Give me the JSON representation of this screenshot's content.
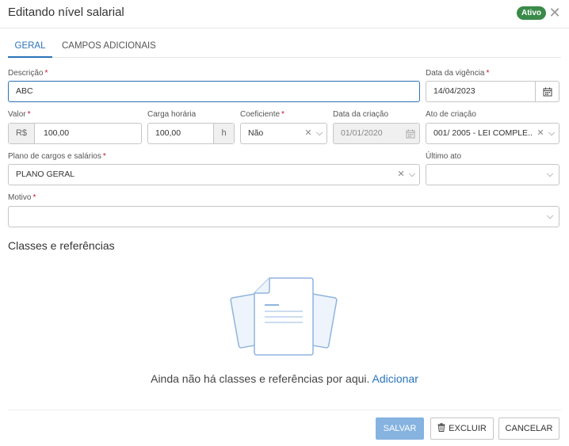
{
  "dialog": {
    "title": "Editando nível salarial",
    "status_badge": "Ativo"
  },
  "tabs": [
    {
      "label": "GERAL",
      "active": true
    },
    {
      "label": "CAMPOS ADICIONAIS",
      "active": false
    }
  ],
  "form": {
    "descricao": {
      "label": "Descrição",
      "required": true,
      "value": "ABC"
    },
    "data_vigencia": {
      "label": "Data da vigência",
      "required": true,
      "value": "14/04/2023"
    },
    "valor": {
      "label": "Valor",
      "required": true,
      "prefix": "R$",
      "value": "100,00"
    },
    "carga_horaria": {
      "label": "Carga horária",
      "value": "100,00",
      "suffix": "h"
    },
    "coeficiente": {
      "label": "Coeficiente",
      "required": true,
      "value": "Não"
    },
    "data_criacao": {
      "label": "Data da criação",
      "value": "01/01/2020",
      "disabled": true
    },
    "ato_criacao": {
      "label": "Ato de criação",
      "value": "001/ 2005 - LEI COMPLE..."
    },
    "plano_cargos": {
      "label": "Plano de cargos e salários",
      "required": true,
      "value": "PLANO GERAL"
    },
    "ultimo_ato": {
      "label": "Último ato",
      "value": ""
    },
    "motivo": {
      "label": "Motivo",
      "required": true,
      "value": ""
    }
  },
  "classes_section": {
    "title": "Classes e referências",
    "empty_message": "Ainda não há classes e referências por aqui.",
    "add_link": "Adicionar"
  },
  "footer": {
    "save_label": "SALVAR",
    "delete_label": "EXCLUIR",
    "cancel_label": "CANCELAR"
  },
  "colors": {
    "accent": "#2a73b8",
    "badge": "#3a8a4a",
    "required": "#c8102e",
    "save_button": "#86b3e0"
  },
  "icons": {
    "close": "close-icon",
    "calendar": "calendar-icon",
    "clear": "clear-icon",
    "chevron": "chevron-down-icon",
    "trash": "trash-icon",
    "empty_state": "documents-illustration"
  }
}
